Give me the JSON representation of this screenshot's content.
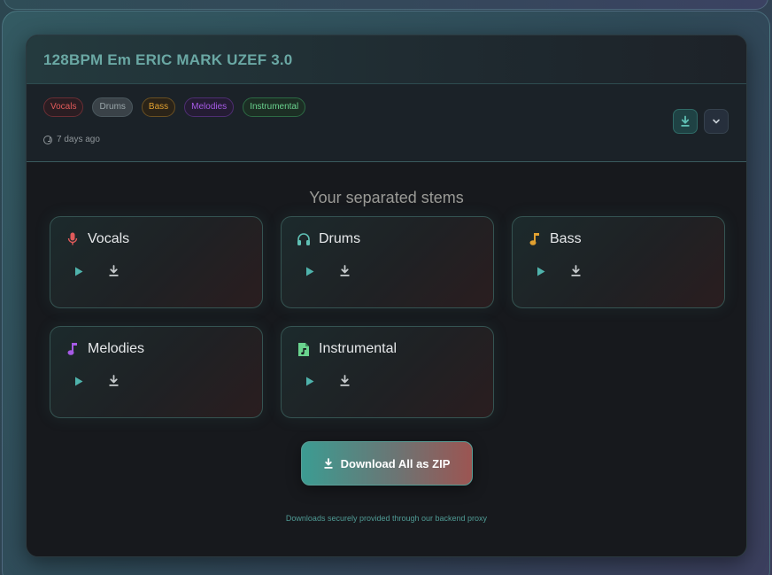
{
  "card": {
    "title": "128BPM Em ERIC MARK UZEF 3.0",
    "tags": [
      "Vocals",
      "Drums",
      "Bass",
      "Melodies",
      "Instrumental"
    ],
    "time_ago": "7 days ago"
  },
  "main": {
    "section_title": "Your separated stems",
    "stems": [
      {
        "label": "Vocals",
        "icon": "microphone-icon",
        "color": "#e05a5a"
      },
      {
        "label": "Drums",
        "icon": "headphones-icon",
        "color": "#5fc0b4"
      },
      {
        "label": "Bass",
        "icon": "music-note-icon",
        "color": "#e0a030"
      },
      {
        "label": "Melodies",
        "icon": "music-note-icon",
        "color": "#a65ae6"
      },
      {
        "label": "Instrumental",
        "icon": "audio-file-icon",
        "color": "#6ad38e"
      }
    ],
    "zip_button": "Download All as ZIP",
    "footnote": "Downloads securely provided through our backend proxy"
  },
  "colors": {
    "accent": "#5fc0b4",
    "card_bg": "#17191d",
    "title": "#6aa8a4"
  }
}
